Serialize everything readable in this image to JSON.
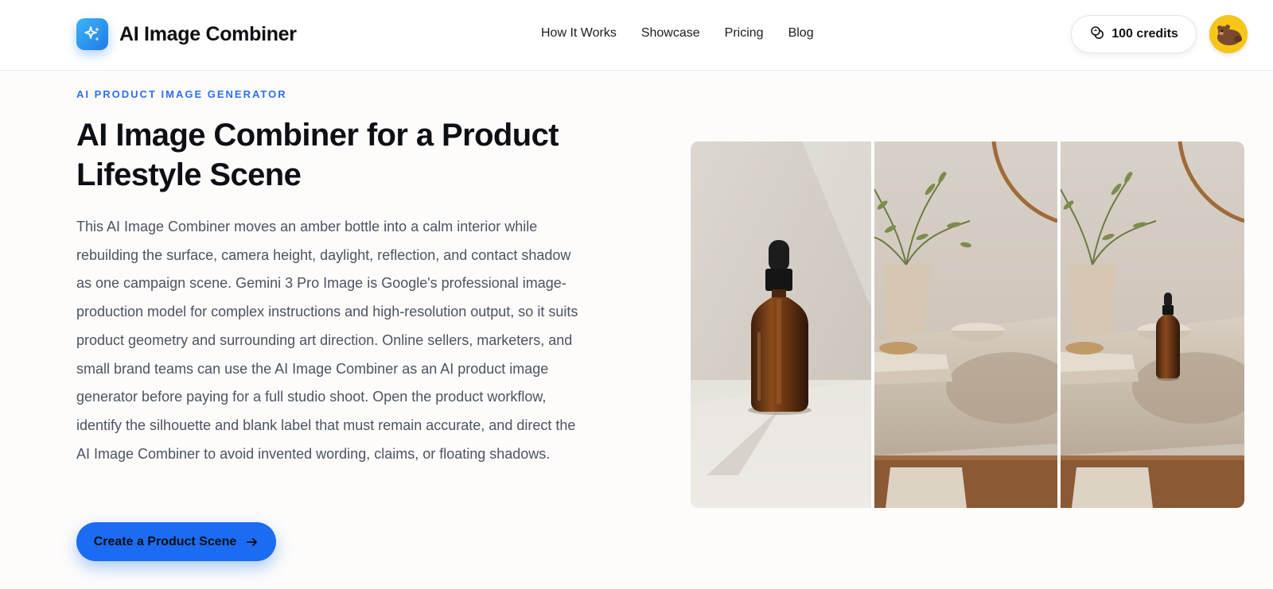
{
  "header": {
    "logo_text": "AI Image Combiner",
    "nav": [
      "How It Works",
      "Showcase",
      "Pricing",
      "Blog"
    ],
    "credits_label": "100 credits"
  },
  "hero": {
    "eyebrow": "AI PRODUCT IMAGE GENERATOR",
    "title": "AI Image Combiner for a Product Lifestyle Scene",
    "body": "This AI Image Combiner moves an amber bottle into a calm interior while rebuilding the surface, camera height, daylight, reflection, and contact shadow as one campaign scene. Gemini 3 Pro Image is Google's professional image-production model for complex instructions and high-resolution output, so it suits product geometry and surrounding art direction. Online sellers, marketers, and small brand teams can use the AI Image Combiner as an AI product image generator before paying for a full studio shoot. Open the product workflow, identify the silhouette and blank label that must remain accurate, and direct the AI Image Combiner to avoid invented wording, claims, or floating shadows.",
    "cta_label": "Create a Product Scene"
  },
  "icons": {
    "logo": "sparkles-icon",
    "credits": "coins-icon",
    "cta": "arrow-right-icon"
  },
  "colors": {
    "accent": "#2b6ff0",
    "cta_bg": "#1b6cf2",
    "avatar_bg": "#f5c518"
  }
}
